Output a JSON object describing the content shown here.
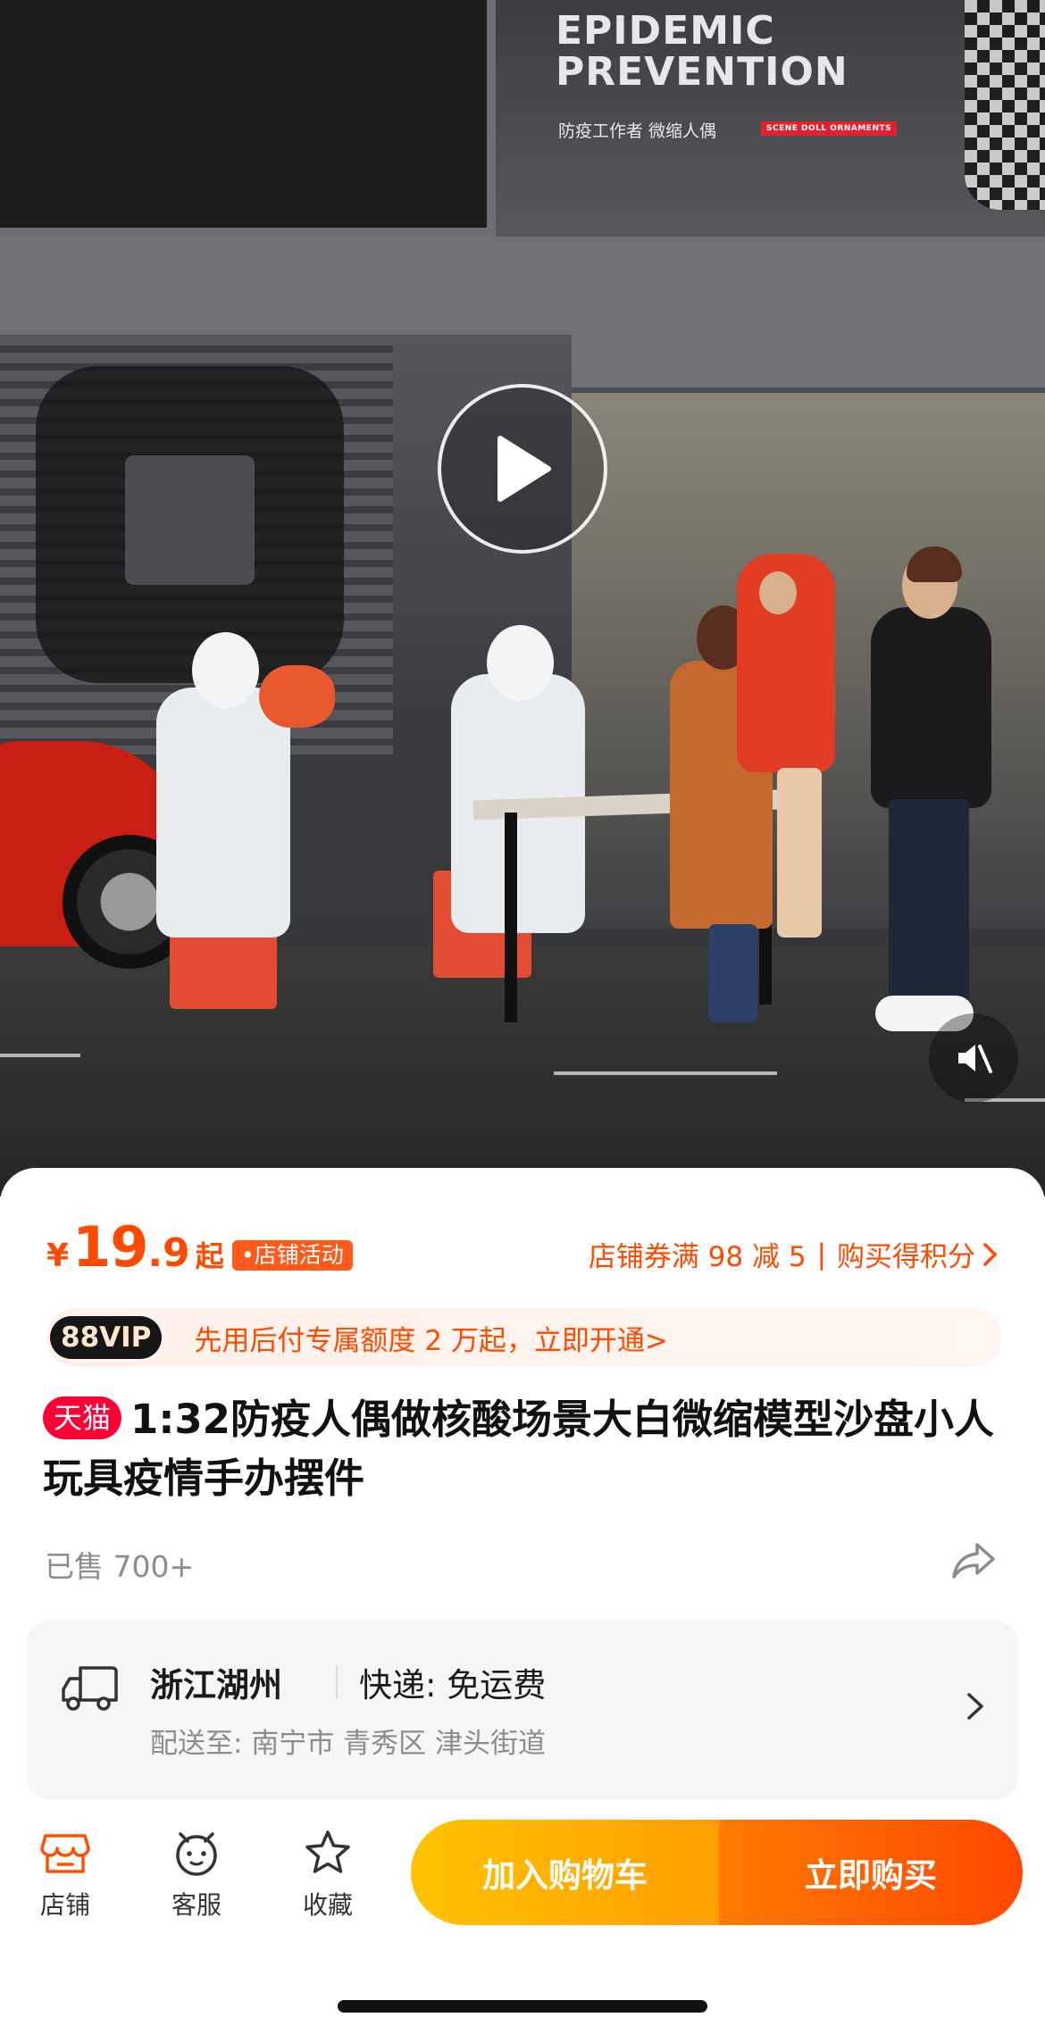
{
  "media": {
    "headline_line1": "EPIDEMIC",
    "headline_line2": "PREVENTION",
    "subtitle_cn": "防疫工作者 微缩人偶",
    "subtitle_tag": "SCENE DOLL ORNAMENTS",
    "play_icon": "play-icon",
    "mute_icon": "mute-icon"
  },
  "price": {
    "currency": "¥",
    "integer": "19",
    "decimal": ".9",
    "suffix": "起",
    "activity_tag": "•店铺活动",
    "coupon_text": "店铺券满 98 减 5",
    "separator": "|",
    "points_text": "购买得积分",
    "accent_color": "#ff4a00"
  },
  "vip": {
    "badge": "88VIP",
    "text": "先用后付专属额度 2 万起，立即开通>"
  },
  "product": {
    "platform_tag": "天猫",
    "title": "1:32防疫人偶做核酸场景大白微缩模型沙盘小人玩具疫情手办摆件",
    "sold": "已售 700+"
  },
  "delivery": {
    "from": "浙江湖州",
    "method": "快递:  免运费",
    "to": "配送至: 南宁市 青秀区 津头街道"
  },
  "bottom_bar": {
    "tabs": [
      {
        "label": "店铺",
        "icon": "store-icon"
      },
      {
        "label": "客服",
        "icon": "customer-service-icon"
      },
      {
        "label": "收藏",
        "icon": "star-icon"
      }
    ],
    "add_to_cart": "加入购物车",
    "buy_now": "立即购买"
  }
}
